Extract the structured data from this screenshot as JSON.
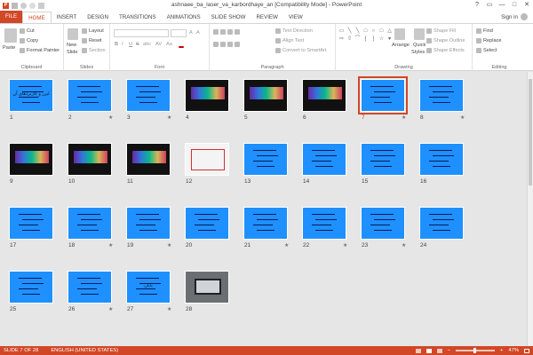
{
  "window": {
    "title": "ashnaee_ba_laser_va_karbordhaye_an [Compatibility Mode] - PowerPoint",
    "app_icon": "P",
    "controls": [
      "?",
      "▭",
      "—",
      "□",
      "✕"
    ]
  },
  "tabs": [
    "FILE",
    "HOME",
    "INSERT",
    "DESIGN",
    "TRANSITIONS",
    "ANIMATIONS",
    "SLIDE SHOW",
    "REVIEW",
    "VIEW"
  ],
  "active_tab": "HOME",
  "signin": "Sign in",
  "ribbon": {
    "clipboard": {
      "paste": "Paste",
      "cut": "Cut",
      "copy": "Copy",
      "format_painter": "Format Painter",
      "label": "Clipboard"
    },
    "slides": {
      "new_slide": "New",
      "new_slide2": "Slide",
      "layout": "Layout",
      "reset": "Reset",
      "section": "Section",
      "label": "Slides"
    },
    "font": {
      "label": "Font",
      "bold": "B",
      "italic": "I",
      "underline": "U",
      "strike": "S",
      "shadow": "abc",
      "spacing": "AV",
      "case": "Aa",
      "grow": "A",
      "shrink": "A"
    },
    "paragraph": {
      "text_direction": "Text Direction",
      "align_text": "Align Text",
      "convert": "Convert to SmartArt",
      "label": "Paragraph"
    },
    "drawing": {
      "arrange": "Arrange",
      "quick_styles": "Quick",
      "quick_styles2": "Styles",
      "shape_fill": "Shape Fill",
      "shape_outline": "Shape Outline",
      "shape_effects": "Shape Effects",
      "label": "Drawing"
    },
    "editing": {
      "find": "Find",
      "replace": "Replace",
      "select": "Select",
      "label": "Editing"
    }
  },
  "slides": [
    {
      "n": "1",
      "kind": "blue",
      "title": "لیزر و کاربردهای آن",
      "star": ""
    },
    {
      "n": "2",
      "kind": "blue",
      "star": "★"
    },
    {
      "n": "3",
      "kind": "blue",
      "star": "★"
    },
    {
      "n": "4",
      "kind": "dark",
      "star": ""
    },
    {
      "n": "5",
      "kind": "dark",
      "star": ""
    },
    {
      "n": "6",
      "kind": "dark",
      "star": ""
    },
    {
      "n": "7",
      "kind": "blue",
      "star": "★"
    },
    {
      "n": "8",
      "kind": "blue",
      "star": "★"
    },
    {
      "n": "9",
      "kind": "dark",
      "star": ""
    },
    {
      "n": "10",
      "kind": "dark",
      "star": ""
    },
    {
      "n": "11",
      "kind": "dark",
      "star": ""
    },
    {
      "n": "12",
      "kind": "white",
      "star": ""
    },
    {
      "n": "13",
      "kind": "blue",
      "star": ""
    },
    {
      "n": "14",
      "kind": "blue",
      "star": ""
    },
    {
      "n": "15",
      "kind": "blue",
      "star": ""
    },
    {
      "n": "16",
      "kind": "blue",
      "star": ""
    },
    {
      "n": "17",
      "kind": "blue",
      "star": ""
    },
    {
      "n": "18",
      "kind": "blue",
      "star": "★"
    },
    {
      "n": "19",
      "kind": "blue",
      "star": "★"
    },
    {
      "n": "20",
      "kind": "blue",
      "star": ""
    },
    {
      "n": "21",
      "kind": "blue",
      "star": "★"
    },
    {
      "n": "22",
      "kind": "blue",
      "star": "★"
    },
    {
      "n": "23",
      "kind": "blue",
      "star": "★"
    },
    {
      "n": "24",
      "kind": "blue",
      "star": ""
    },
    {
      "n": "25",
      "kind": "blue",
      "star": ""
    },
    {
      "n": "26",
      "kind": "blue",
      "star": "★"
    },
    {
      "n": "27",
      "kind": "blue",
      "title": "پایان",
      "star": "★"
    },
    {
      "n": "28",
      "kind": "photo",
      "star": ""
    }
  ],
  "selected_slide": "7",
  "status": {
    "slide_info": "SLIDE 7 OF 28",
    "language": "ENGLISH (UNITED STATES)",
    "zoom": "47%",
    "zoom_minus": "−",
    "zoom_plus": "+"
  },
  "colors": {
    "accent": "#d24726",
    "slide_blue": "#1e90ff"
  }
}
